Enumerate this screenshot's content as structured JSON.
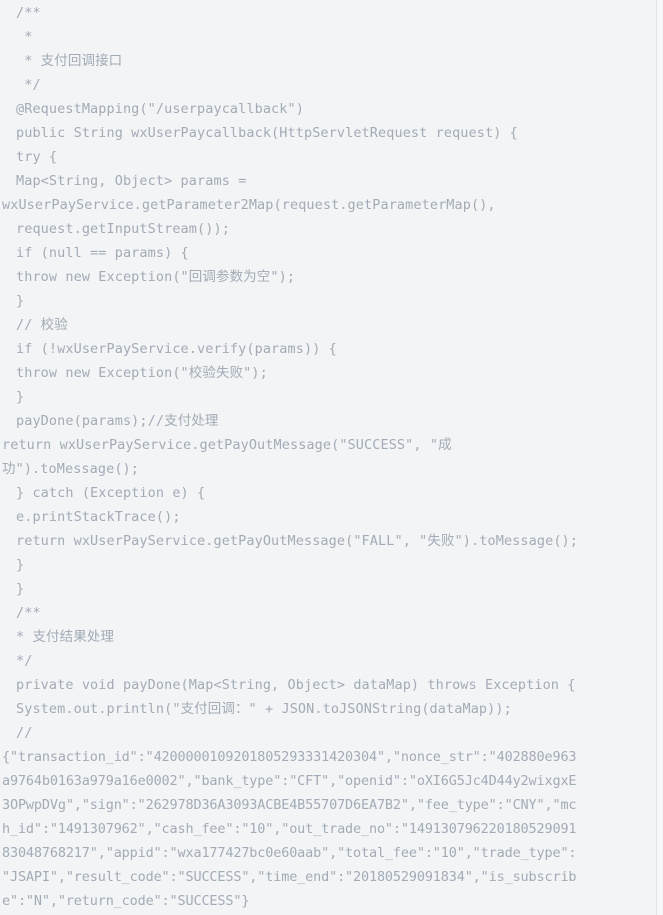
{
  "document": {
    "type": "code-snippet",
    "language": "java",
    "background_color": "#f2f4f5",
    "text_color": "#a3abb6",
    "watermark": "· · · ·",
    "lines": [
      "/**",
      " *",
      " * 支付回调接口",
      " */",
      "@RequestMapping(\"/userpaycallback\")",
      "public String wxUserPaycallback(HttpServletRequest request) {",
      "try {",
      "Map<String, Object> params =",
      "wxUserPayService.getParameter2Map(request.getParameterMap(),",
      "request.getInputStream());",
      "if (null == params) {",
      "throw new Exception(\"回调参数为空\");",
      "}",
      "// 校验",
      "if (!wxUserPayService.verify(params)) {",
      "throw new Exception(\"校验失败\");",
      "}",
      "payDone(params);//支付处理",
      "return wxUserPayService.getPayOutMessage(\"SUCCESS\", \"成",
      "功\").toMessage();",
      "} catch (Exception e) {",
      "e.printStackTrace();",
      "return wxUserPayService.getPayOutMessage(\"FALL\", \"失败\").toMessage();",
      "}",
      "}",
      "/**",
      "* 支付结果处理",
      "*/",
      "private void payDone(Map<String, Object> dataMap) throws Exception {",
      "System.out.println(\"支付回调：\" + JSON.toJSONString(dataMap));",
      "//"
    ],
    "line_indent_flush": [
      8,
      18,
      19
    ],
    "json_payload_lines": [
      "{\"transaction_id\":\"4200000109201805293331420304\",\"nonce_str\":\"402880e963",
      "a9764b0163a979a16e0002\",\"bank_type\":\"CFT\",\"openid\":\"oXI6G5Jc4D44y2wixgxE",
      "3OPwpDVg\",\"sign\":\"262978D36A3093ACBE4B55707D6EA7B2\",\"fee_type\":\"CNY\",\"mc",
      "h_id\":\"1491307962\",\"cash_fee\":\"10\",\"out_trade_no\":\"149130796220180529091",
      "83048768217\",\"appid\":\"wxa177427bc0e60aab\",\"total_fee\":\"10\",\"trade_type\":",
      "\"JSAPI\",\"result_code\":\"SUCCESS\",\"time_end\":\"20180529091834\",\"is_subscrib",
      "e\":\"N\",\"return_code\":\"SUCCESS\"}"
    ],
    "payload_fields": {
      "transaction_id": "4200000109201805293331420304",
      "nonce_str": "402880e963a9764b0163a979a16e0002",
      "bank_type": "CFT",
      "openid": "oXI6G5Jc4D44y2wixgxE3OPwpDVg",
      "sign": "262978D36A3093ACBE4B55707D6EA7B2",
      "fee_type": "CNY",
      "mch_id": "1491307962",
      "cash_fee": "10",
      "out_trade_no": "1491307962201805290918 3048768217",
      "appid": "wxa177427bc0e60aab",
      "total_fee": "10",
      "trade_type": "JSAPI",
      "result_code": "SUCCESS",
      "time_end": "20180529091834",
      "is_subscribe": "N",
      "return_code": "SUCCESS"
    }
  }
}
